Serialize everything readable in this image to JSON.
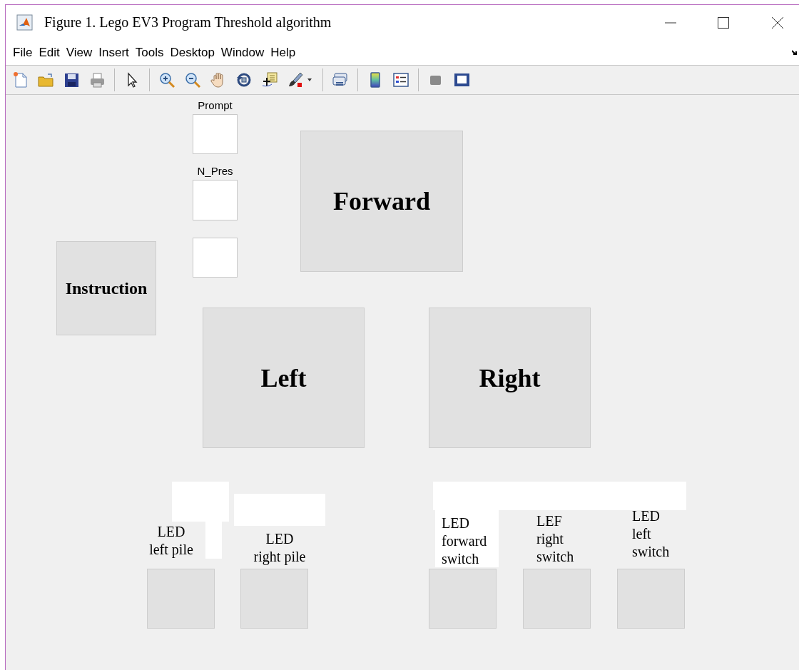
{
  "window": {
    "title": "Figure 1. Lego EV3 Program Threshold algorithm"
  },
  "menu": [
    "File",
    "Edit",
    "View",
    "Insert",
    "Tools",
    "Desktop",
    "Window",
    "Help"
  ],
  "controls": [
    {
      "kind": "label",
      "text": "Prompt"
    },
    {
      "kind": "edit"
    },
    {
      "kind": "label",
      "text": "N_Pres"
    },
    {
      "kind": "edit"
    },
    {
      "kind": "edit"
    },
    {
      "kind": "button",
      "text": "Forward"
    },
    {
      "kind": "button",
      "text": "Instruction"
    },
    {
      "kind": "button",
      "text": "Left"
    },
    {
      "kind": "button",
      "text": "Right"
    },
    {
      "kind": "blank"
    },
    {
      "kind": "blank"
    },
    {
      "kind": "caption",
      "text": "LED\nleft pile"
    },
    {
      "kind": "blank"
    },
    {
      "kind": "caption",
      "text": "LED\nright pile"
    },
    {
      "kind": "blank"
    },
    {
      "kind": "boxed-caption",
      "text": "LED\nforward\nswitch"
    },
    {
      "kind": "caption",
      "text": "LEF\nright\nswitch"
    },
    {
      "kind": "caption",
      "text": "LED\nleft\nswitch"
    },
    {
      "kind": "lamp"
    },
    {
      "kind": "lamp"
    },
    {
      "kind": "lamp"
    },
    {
      "kind": "lamp"
    },
    {
      "kind": "lamp"
    }
  ]
}
